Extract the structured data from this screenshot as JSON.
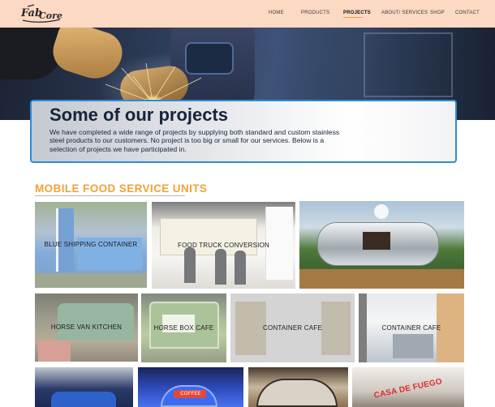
{
  "logo": {
    "alt_text": "Fab Core"
  },
  "nav": {
    "items": [
      {
        "label": "HOME"
      },
      {
        "label": "PRODUCTS"
      },
      {
        "label": "PROJECTS"
      },
      {
        "label": "ABOUT/ SERVICES"
      },
      {
        "label": "SHOP"
      },
      {
        "label": "CONTACT"
      }
    ],
    "active": "PROJECTS",
    "accent_color": "#f2a33c"
  },
  "intro": {
    "title": "Some of our projects",
    "body": "We have completed a wide range of projects by supplying both standard and custom stainless steel products to our customers. No project is too big or small for our services. Below is a selection of projects we have participated in."
  },
  "section": {
    "title": "MOBILE FOOD SERVICE UNITS",
    "color": "#f0a23a"
  },
  "projects": [
    {
      "caption": "BLUE SHIPPING CONTAINER"
    },
    {
      "caption": "FOOD TRUCK CONVERSION"
    },
    {
      "caption": ""
    },
    {
      "caption": "HORSE VAN KITCHEN"
    },
    {
      "caption": "HORSE BOX CAFE"
    },
    {
      "caption": "CONTAINER CAFE"
    },
    {
      "caption": "CONTAINER CAFE"
    },
    {
      "caption": ""
    },
    {
      "caption": "COFFEE"
    },
    {
      "caption": ""
    },
    {
      "caption": "CASA DE FUEGO"
    }
  ]
}
